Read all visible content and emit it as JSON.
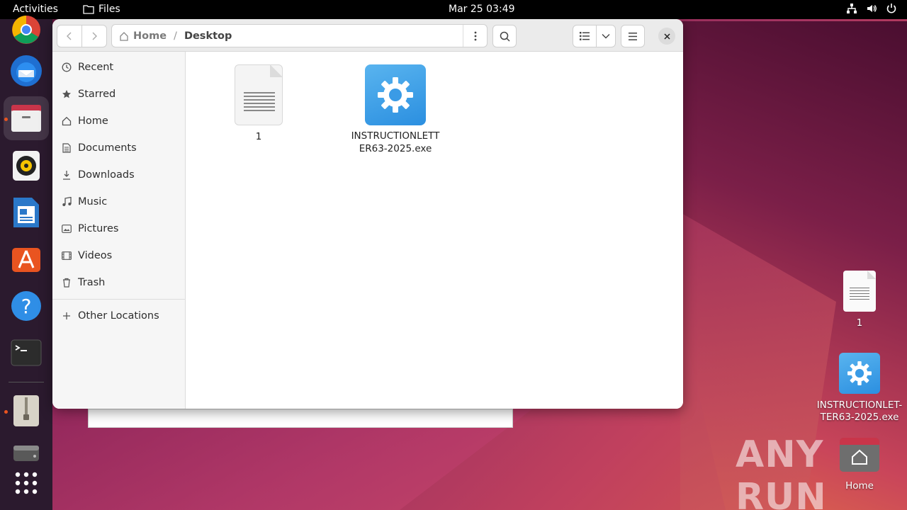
{
  "topbar": {
    "activities": "Activities",
    "app_name": "Files",
    "clock": "Mar 25  03:49"
  },
  "dock": {
    "items": [
      "chrome-icon",
      "thunderbird-icon",
      "files-icon",
      "rhythmbox-icon",
      "writer-icon",
      "app-center-icon",
      "help-icon",
      "terminal-icon",
      "archive-icon",
      "disk-icon",
      "app-grid-icon"
    ]
  },
  "window": {
    "path_home": "Home",
    "path_sep": "/",
    "path_current": "Desktop",
    "sidebar": {
      "items": [
        {
          "label": "Recent",
          "icon": "clock-icon"
        },
        {
          "label": "Starred",
          "icon": "star-icon"
        },
        {
          "label": "Home",
          "icon": "home-icon"
        },
        {
          "label": "Documents",
          "icon": "document-icon"
        },
        {
          "label": "Downloads",
          "icon": "download-icon"
        },
        {
          "label": "Music",
          "icon": "music-icon"
        },
        {
          "label": "Pictures",
          "icon": "picture-icon"
        },
        {
          "label": "Videos",
          "icon": "video-icon"
        },
        {
          "label": "Trash",
          "icon": "trash-icon"
        }
      ],
      "other_locations": "Other Locations"
    },
    "files": [
      {
        "name": "1",
        "type": "text"
      },
      {
        "name_line1": "INSTRUCTIONLETT",
        "name_line2": "ER63-2025.exe",
        "type": "exe"
      }
    ]
  },
  "desktop": {
    "icons": [
      {
        "label": "1"
      },
      {
        "label_line1": "INSTRUCTIONLET-",
        "label_line2": "TER63-2025.exe"
      },
      {
        "label": "Home"
      }
    ],
    "watermark": "ANY RUN"
  },
  "colors": {
    "accent": "#e95420",
    "exe_icon": "#3a9be6",
    "dock_bg": "#2b1a2e"
  }
}
